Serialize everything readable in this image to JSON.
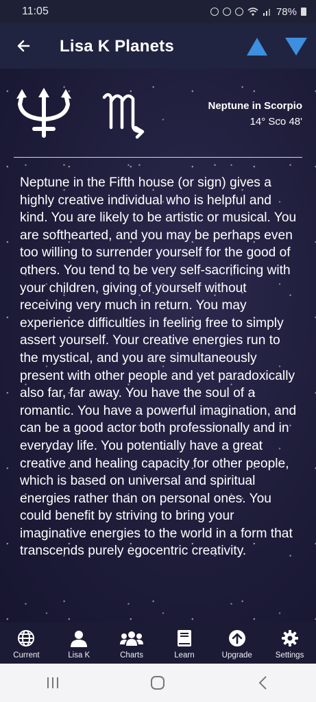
{
  "status": {
    "time": "11:05",
    "battery": "78%"
  },
  "header": {
    "title": "Lisa K Planets"
  },
  "planet": {
    "glyph": "neptune-icon",
    "sign_glyph": "scorpio-icon",
    "title": "Neptune in Scorpio",
    "degree": "14° Sco 48'"
  },
  "description": "Neptune in the Fifth house (or sign) gives a highly creative individual who is helpful and kind. You are likely to be artistic or musical. You are softhearted, and you may be perhaps even too willing to surrender yourself for the good of others. You tend to be very self-sacrificing with your children, giving of yourself without receiving very much in return. You may experience difficulties in feeling free to simply assert yourself. Your creative energies run to the mystical, and you are simultaneously present with other people and yet paradoxically also far, far away. You have the soul of a romantic. You have a powerful imagination, and can be a good actor both professionally and in everyday life. You potentially have a great creative and healing capacity for other people, which is based on universal and spiritual energies rather than on personal ones. You could benefit by striving to bring your imaginative energies to the world in a form that transcends purely egocentric creativity.",
  "nav": {
    "items": [
      {
        "label": "Current",
        "icon": "globe-icon"
      },
      {
        "label": "Lisa K",
        "icon": "person-icon"
      },
      {
        "label": "Charts",
        "icon": "group-icon"
      },
      {
        "label": "Learn",
        "icon": "book-icon"
      },
      {
        "label": "Upgrade",
        "icon": "upload-circle-icon"
      },
      {
        "label": "Settings",
        "icon": "gear-icon"
      }
    ]
  },
  "colors": {
    "accent": "#3d8fe0",
    "background": "#1b1a35"
  }
}
